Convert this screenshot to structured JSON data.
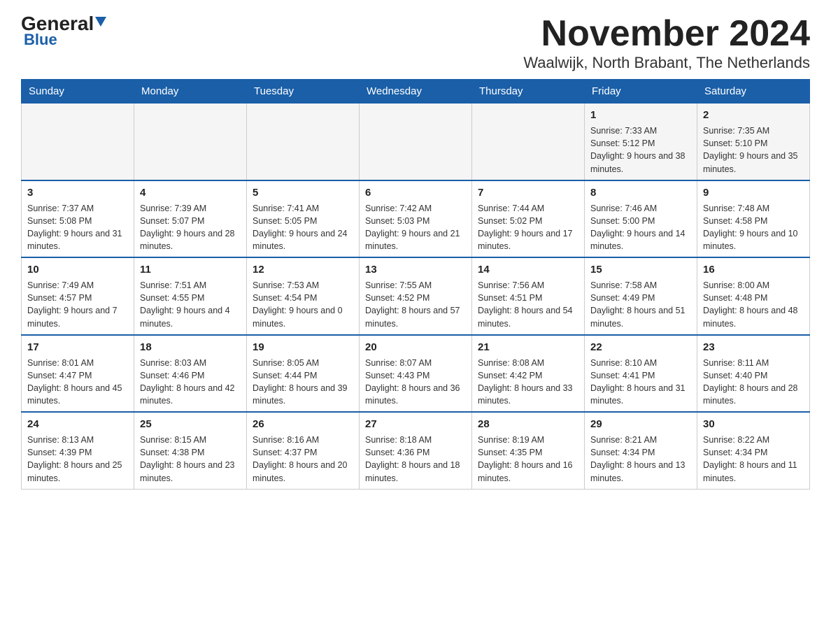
{
  "logo": {
    "general": "General",
    "blue": "Blue",
    "triangle": true
  },
  "title": {
    "month_year": "November 2024",
    "location": "Waalwijk, North Brabant, The Netherlands"
  },
  "weekdays": [
    "Sunday",
    "Monday",
    "Tuesday",
    "Wednesday",
    "Thursday",
    "Friday",
    "Saturday"
  ],
  "weeks": [
    [
      {
        "day": "",
        "info": ""
      },
      {
        "day": "",
        "info": ""
      },
      {
        "day": "",
        "info": ""
      },
      {
        "day": "",
        "info": ""
      },
      {
        "day": "",
        "info": ""
      },
      {
        "day": "1",
        "info": "Sunrise: 7:33 AM\nSunset: 5:12 PM\nDaylight: 9 hours and 38 minutes."
      },
      {
        "day": "2",
        "info": "Sunrise: 7:35 AM\nSunset: 5:10 PM\nDaylight: 9 hours and 35 minutes."
      }
    ],
    [
      {
        "day": "3",
        "info": "Sunrise: 7:37 AM\nSunset: 5:08 PM\nDaylight: 9 hours and 31 minutes."
      },
      {
        "day": "4",
        "info": "Sunrise: 7:39 AM\nSunset: 5:07 PM\nDaylight: 9 hours and 28 minutes."
      },
      {
        "day": "5",
        "info": "Sunrise: 7:41 AM\nSunset: 5:05 PM\nDaylight: 9 hours and 24 minutes."
      },
      {
        "day": "6",
        "info": "Sunrise: 7:42 AM\nSunset: 5:03 PM\nDaylight: 9 hours and 21 minutes."
      },
      {
        "day": "7",
        "info": "Sunrise: 7:44 AM\nSunset: 5:02 PM\nDaylight: 9 hours and 17 minutes."
      },
      {
        "day": "8",
        "info": "Sunrise: 7:46 AM\nSunset: 5:00 PM\nDaylight: 9 hours and 14 minutes."
      },
      {
        "day": "9",
        "info": "Sunrise: 7:48 AM\nSunset: 4:58 PM\nDaylight: 9 hours and 10 minutes."
      }
    ],
    [
      {
        "day": "10",
        "info": "Sunrise: 7:49 AM\nSunset: 4:57 PM\nDaylight: 9 hours and 7 minutes."
      },
      {
        "day": "11",
        "info": "Sunrise: 7:51 AM\nSunset: 4:55 PM\nDaylight: 9 hours and 4 minutes."
      },
      {
        "day": "12",
        "info": "Sunrise: 7:53 AM\nSunset: 4:54 PM\nDaylight: 9 hours and 0 minutes."
      },
      {
        "day": "13",
        "info": "Sunrise: 7:55 AM\nSunset: 4:52 PM\nDaylight: 8 hours and 57 minutes."
      },
      {
        "day": "14",
        "info": "Sunrise: 7:56 AM\nSunset: 4:51 PM\nDaylight: 8 hours and 54 minutes."
      },
      {
        "day": "15",
        "info": "Sunrise: 7:58 AM\nSunset: 4:49 PM\nDaylight: 8 hours and 51 minutes."
      },
      {
        "day": "16",
        "info": "Sunrise: 8:00 AM\nSunset: 4:48 PM\nDaylight: 8 hours and 48 minutes."
      }
    ],
    [
      {
        "day": "17",
        "info": "Sunrise: 8:01 AM\nSunset: 4:47 PM\nDaylight: 8 hours and 45 minutes."
      },
      {
        "day": "18",
        "info": "Sunrise: 8:03 AM\nSunset: 4:46 PM\nDaylight: 8 hours and 42 minutes."
      },
      {
        "day": "19",
        "info": "Sunrise: 8:05 AM\nSunset: 4:44 PM\nDaylight: 8 hours and 39 minutes."
      },
      {
        "day": "20",
        "info": "Sunrise: 8:07 AM\nSunset: 4:43 PM\nDaylight: 8 hours and 36 minutes."
      },
      {
        "day": "21",
        "info": "Sunrise: 8:08 AM\nSunset: 4:42 PM\nDaylight: 8 hours and 33 minutes."
      },
      {
        "day": "22",
        "info": "Sunrise: 8:10 AM\nSunset: 4:41 PM\nDaylight: 8 hours and 31 minutes."
      },
      {
        "day": "23",
        "info": "Sunrise: 8:11 AM\nSunset: 4:40 PM\nDaylight: 8 hours and 28 minutes."
      }
    ],
    [
      {
        "day": "24",
        "info": "Sunrise: 8:13 AM\nSunset: 4:39 PM\nDaylight: 8 hours and 25 minutes."
      },
      {
        "day": "25",
        "info": "Sunrise: 8:15 AM\nSunset: 4:38 PM\nDaylight: 8 hours and 23 minutes."
      },
      {
        "day": "26",
        "info": "Sunrise: 8:16 AM\nSunset: 4:37 PM\nDaylight: 8 hours and 20 minutes."
      },
      {
        "day": "27",
        "info": "Sunrise: 8:18 AM\nSunset: 4:36 PM\nDaylight: 8 hours and 18 minutes."
      },
      {
        "day": "28",
        "info": "Sunrise: 8:19 AM\nSunset: 4:35 PM\nDaylight: 8 hours and 16 minutes."
      },
      {
        "day": "29",
        "info": "Sunrise: 8:21 AM\nSunset: 4:34 PM\nDaylight: 8 hours and 13 minutes."
      },
      {
        "day": "30",
        "info": "Sunrise: 8:22 AM\nSunset: 4:34 PM\nDaylight: 8 hours and 11 minutes."
      }
    ]
  ]
}
